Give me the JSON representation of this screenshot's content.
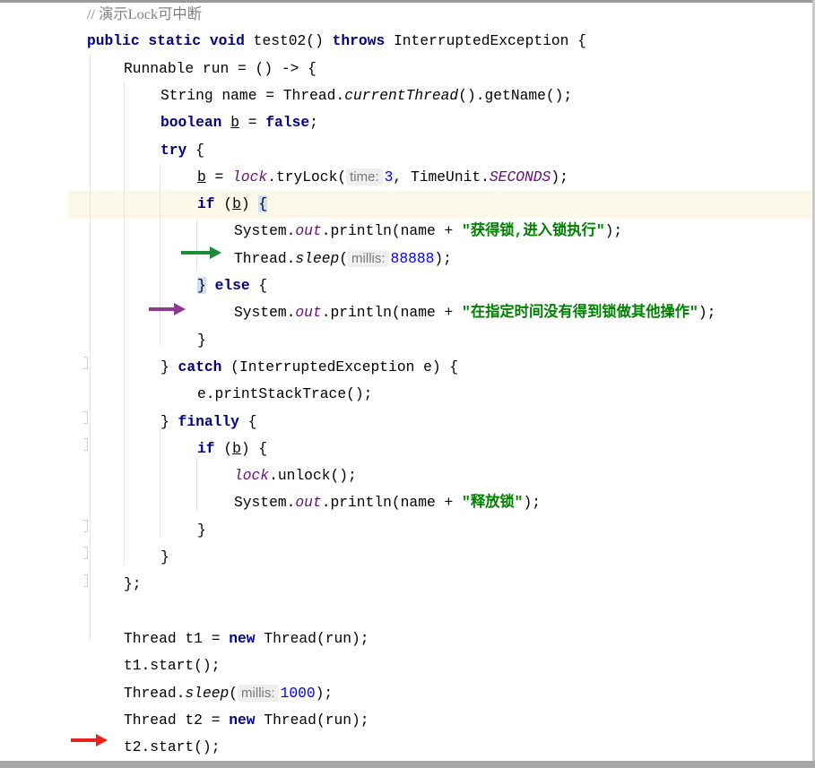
{
  "colors": {
    "green_arrow": "#1e8a3a",
    "purple_arrow": "#8e3a8e",
    "red_arrow": "#e8231d"
  },
  "lines": [
    {
      "indent": 0,
      "tokens": [
        {
          "t": "cm",
          "c": "// 演示Lock可中断"
        }
      ]
    },
    {
      "indent": 0,
      "tokens": [
        {
          "t": "kw",
          "c": "public"
        },
        {
          "t": "p",
          "c": " "
        },
        {
          "t": "kw",
          "c": "static"
        },
        {
          "t": "p",
          "c": " "
        },
        {
          "t": "kw",
          "c": "void"
        },
        {
          "t": "p",
          "c": " test02() "
        },
        {
          "t": "kw",
          "c": "throws"
        },
        {
          "t": "p",
          "c": " InterruptedException {"
        }
      ]
    },
    {
      "indent": 1,
      "tokens": [
        {
          "t": "p",
          "c": "Runnable run = () -> {"
        }
      ]
    },
    {
      "indent": 2,
      "tokens": [
        {
          "t": "p",
          "c": "String name = Thread."
        },
        {
          "t": "sm",
          "c": "currentThread"
        },
        {
          "t": "p",
          "c": "().getName();"
        }
      ]
    },
    {
      "indent": 2,
      "tokens": [
        {
          "t": "kw",
          "c": "boolean"
        },
        {
          "t": "p",
          "c": " "
        },
        {
          "t": "ul",
          "c": "b"
        },
        {
          "t": "p",
          "c": " = "
        },
        {
          "t": "kw",
          "c": "false"
        },
        {
          "t": "p",
          "c": ";"
        }
      ]
    },
    {
      "indent": 2,
      "tokens": [
        {
          "t": "kw",
          "c": "try"
        },
        {
          "t": "p",
          "c": " {"
        }
      ]
    },
    {
      "indent": 3,
      "tokens": [
        {
          "t": "ul",
          "c": "b"
        },
        {
          "t": "p",
          "c": " = "
        },
        {
          "t": "fld",
          "c": "lock"
        },
        {
          "t": "p",
          "c": ".tryLock("
        },
        {
          "t": "hint",
          "c": "time:"
        },
        {
          "t": "num",
          "c": "3"
        },
        {
          "t": "p",
          "c": ", TimeUnit."
        },
        {
          "t": "fld",
          "c": "SECONDS"
        },
        {
          "t": "p",
          "c": ");"
        }
      ]
    },
    {
      "indent": 3,
      "tokens": [
        {
          "t": "kw",
          "c": "if"
        },
        {
          "t": "p",
          "c": " ("
        },
        {
          "t": "ul",
          "c": "b"
        },
        {
          "t": "p",
          "c": ") "
        },
        {
          "t": "brace",
          "c": "{"
        }
      ]
    },
    {
      "indent": 4,
      "tokens": [
        {
          "t": "p",
          "c": "System."
        },
        {
          "t": "fld",
          "c": "out"
        },
        {
          "t": "p",
          "c": ".println(name + "
        },
        {
          "t": "str",
          "c": "\"获得锁,进入锁执行\""
        },
        {
          "t": "p",
          "c": ");"
        }
      ]
    },
    {
      "indent": 4,
      "tokens": [
        {
          "t": "p",
          "c": "Thread."
        },
        {
          "t": "sm",
          "c": "sleep"
        },
        {
          "t": "p",
          "c": "("
        },
        {
          "t": "hint",
          "c": "millis:"
        },
        {
          "t": "num",
          "c": "88888"
        },
        {
          "t": "p",
          "c": ");"
        }
      ]
    },
    {
      "indent": 3,
      "tokens": [
        {
          "t": "brace",
          "c": "}"
        },
        {
          "t": "p",
          "c": " "
        },
        {
          "t": "kw",
          "c": "else"
        },
        {
          "t": "p",
          "c": " {"
        }
      ]
    },
    {
      "indent": 4,
      "tokens": [
        {
          "t": "p",
          "c": "System."
        },
        {
          "t": "fld",
          "c": "out"
        },
        {
          "t": "p",
          "c": ".println(name + "
        },
        {
          "t": "str",
          "c": "\"在指定时间没有得到锁做其他操作\""
        },
        {
          "t": "p",
          "c": ");"
        }
      ]
    },
    {
      "indent": 3,
      "tokens": [
        {
          "t": "p",
          "c": "}"
        }
      ]
    },
    {
      "indent": 2,
      "tokens": [
        {
          "t": "p",
          "c": "} "
        },
        {
          "t": "kw",
          "c": "catch"
        },
        {
          "t": "p",
          "c": " (InterruptedException e) {"
        }
      ]
    },
    {
      "indent": 3,
      "tokens": [
        {
          "t": "p",
          "c": "e.printStackTrace();"
        }
      ]
    },
    {
      "indent": 2,
      "tokens": [
        {
          "t": "p",
          "c": "} "
        },
        {
          "t": "kw",
          "c": "finally"
        },
        {
          "t": "p",
          "c": " {"
        }
      ]
    },
    {
      "indent": 3,
      "tokens": [
        {
          "t": "kw",
          "c": "if"
        },
        {
          "t": "p",
          "c": " ("
        },
        {
          "t": "ul",
          "c": "b"
        },
        {
          "t": "p",
          "c": ") {"
        }
      ]
    },
    {
      "indent": 4,
      "tokens": [
        {
          "t": "fld",
          "c": "lock"
        },
        {
          "t": "p",
          "c": ".unlock();"
        }
      ]
    },
    {
      "indent": 4,
      "tokens": [
        {
          "t": "p",
          "c": "System."
        },
        {
          "t": "fld",
          "c": "out"
        },
        {
          "t": "p",
          "c": ".println(name + "
        },
        {
          "t": "str",
          "c": "\"释放锁\""
        },
        {
          "t": "p",
          "c": ");"
        }
      ]
    },
    {
      "indent": 3,
      "tokens": [
        {
          "t": "p",
          "c": "}"
        }
      ]
    },
    {
      "indent": 2,
      "tokens": [
        {
          "t": "p",
          "c": "}"
        }
      ]
    },
    {
      "indent": 1,
      "tokens": [
        {
          "t": "p",
          "c": "};"
        }
      ]
    },
    {
      "indent": 1,
      "tokens": []
    },
    {
      "indent": 1,
      "tokens": [
        {
          "t": "p",
          "c": "Thread t1 = "
        },
        {
          "t": "kw",
          "c": "new"
        },
        {
          "t": "p",
          "c": " Thread(run);"
        }
      ]
    },
    {
      "indent": 1,
      "tokens": [
        {
          "t": "p",
          "c": "t1.start();"
        }
      ]
    },
    {
      "indent": 1,
      "tokens": [
        {
          "t": "p",
          "c": "Thread."
        },
        {
          "t": "sm",
          "c": "sleep"
        },
        {
          "t": "p",
          "c": "("
        },
        {
          "t": "hint",
          "c": "millis:"
        },
        {
          "t": "num",
          "c": "1000"
        },
        {
          "t": "p",
          "c": ");"
        }
      ]
    },
    {
      "indent": 1,
      "tokens": [
        {
          "t": "p",
          "c": "Thread t2 = "
        },
        {
          "t": "kw",
          "c": "new"
        },
        {
          "t": "p",
          "c": " Thread(run);"
        }
      ]
    },
    {
      "indent": 1,
      "tokens": [
        {
          "t": "p",
          "c": "t2.start();"
        }
      ]
    }
  ]
}
